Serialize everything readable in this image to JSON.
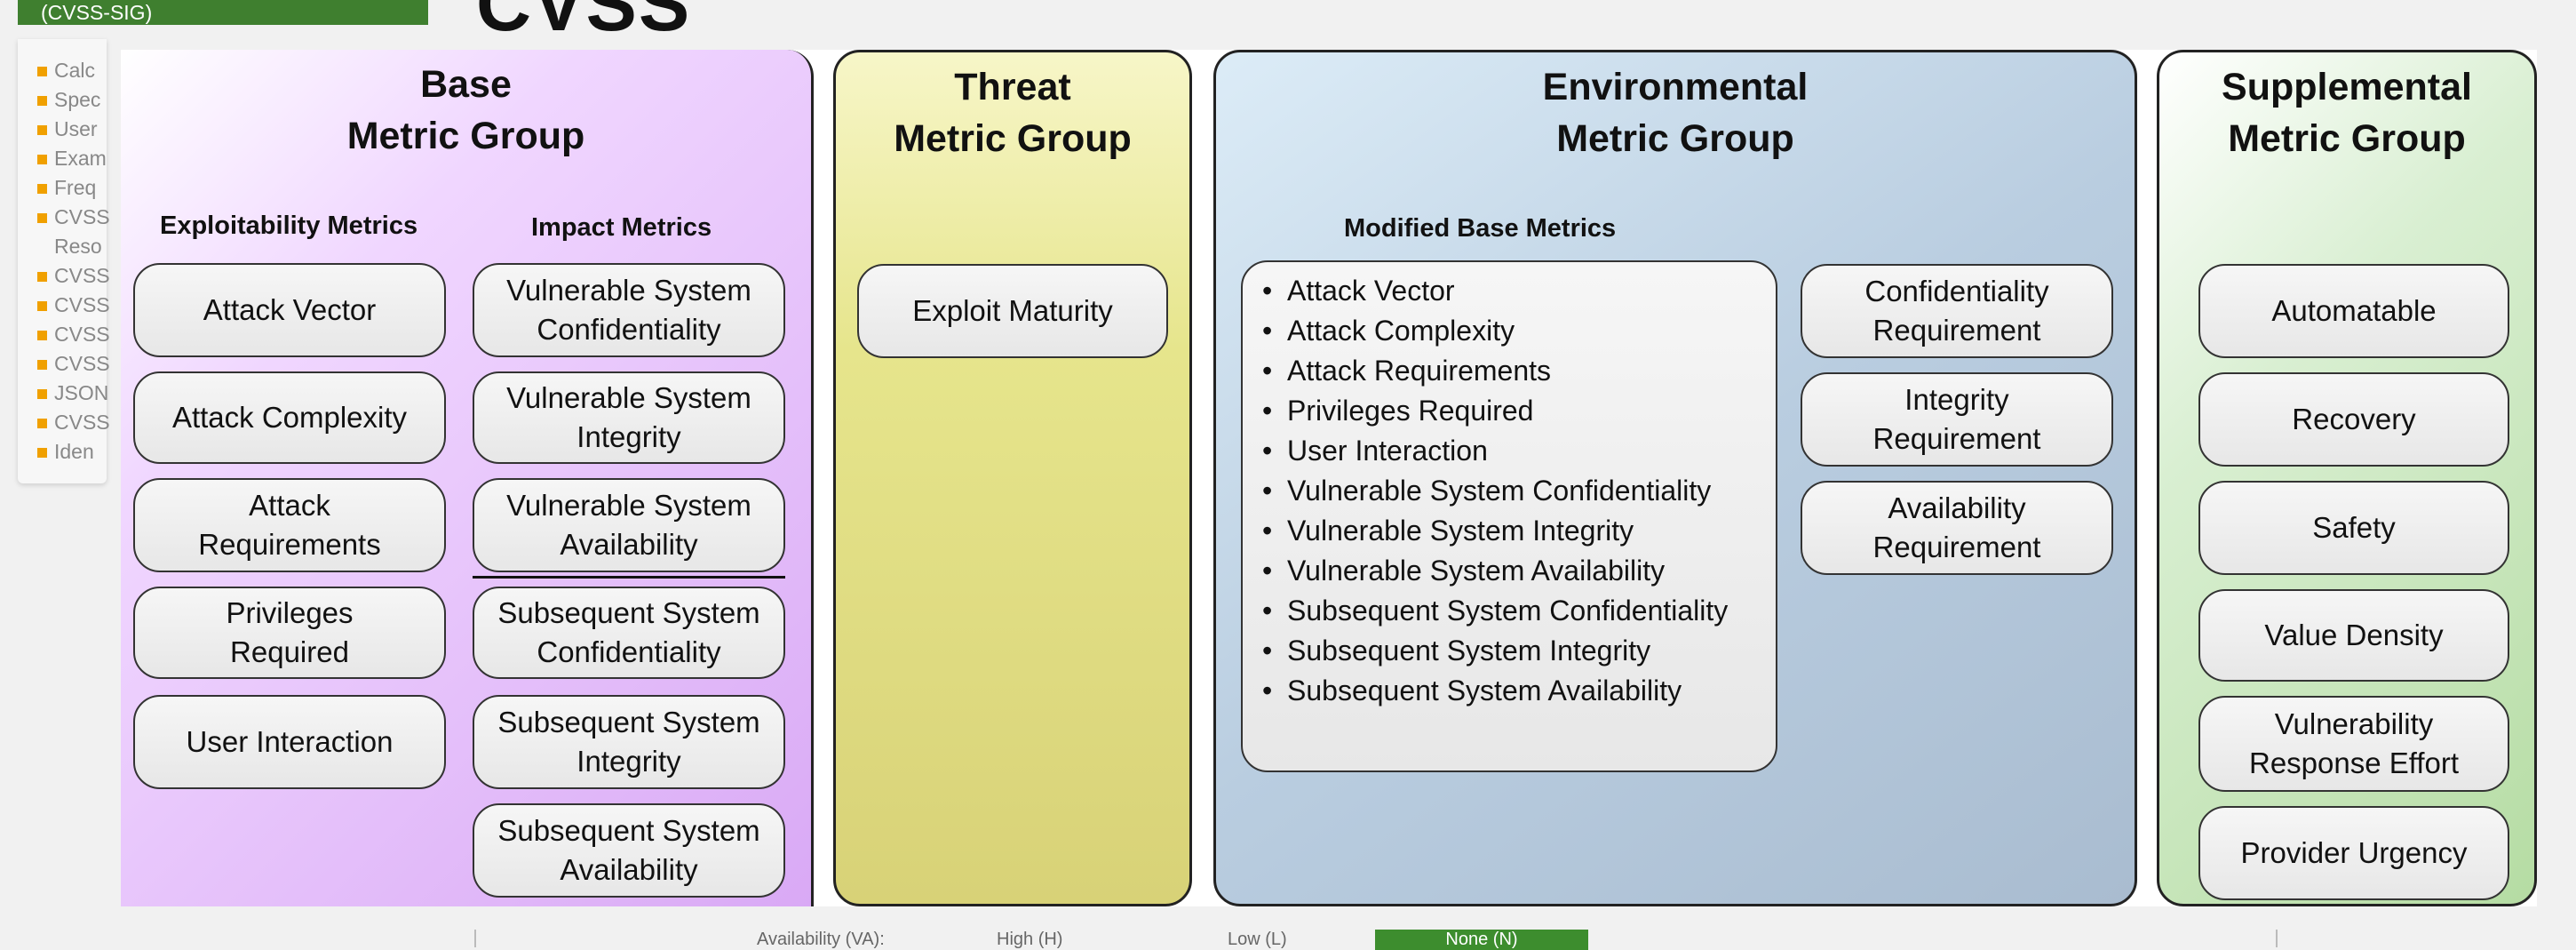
{
  "background": {
    "header_text": "(CVSS-SIG)",
    "logo_text": "CVSS",
    "sidebar_items": [
      "Calc",
      "Spec",
      "User",
      "Exam",
      "Freq",
      "CVSS",
      "Reso",
      "CVSS",
      "CVSS",
      "CVSS",
      "CVSS",
      "JSON",
      "CVSS",
      "Iden"
    ],
    "bottom_row": {
      "label": "Availability (VA):",
      "opt1": "High (H)",
      "opt2": "Low (L)",
      "opt3": "None (N)"
    }
  },
  "groups": {
    "base": {
      "title": [
        "Base",
        "Metric Group"
      ],
      "exploitability_heading": "Exploitability Metrics",
      "impact_heading": "Impact Metrics",
      "exploitability": [
        "Attack Vector",
        "Attack Complexity",
        "Attack\nRequirements",
        "Privileges\nRequired",
        "User Interaction"
      ],
      "impact": [
        "Vulnerable System\nConfidentiality",
        "Vulnerable System\nIntegrity",
        "Vulnerable System\nAvailability",
        "Subsequent System\nConfidentiality",
        "Subsequent System\nIntegrity",
        "Subsequent System\nAvailability"
      ]
    },
    "threat": {
      "title": [
        "Threat",
        "Metric Group"
      ],
      "items": [
        "Exploit Maturity"
      ]
    },
    "environmental": {
      "title": [
        "Environmental",
        "Metric Group"
      ],
      "modified_heading": "Modified Base Metrics",
      "modified": [
        "Attack Vector",
        "Attack Complexity",
        "Attack Requirements",
        "Privileges Required",
        "User Interaction",
        "Vulnerable System Confidentiality",
        "Vulnerable System Integrity",
        "Vulnerable System Availability",
        "Subsequent System Confidentiality",
        "Subsequent System Integrity",
        "Subsequent System Availability"
      ],
      "requirements": [
        "Confidentiality\nRequirement",
        "Integrity\nRequirement",
        "Availability\nRequirement"
      ]
    },
    "supplemental": {
      "title": [
        "Supplemental",
        "Metric Group"
      ],
      "items": [
        "Automatable",
        "Recovery",
        "Safety",
        "Value Density",
        "Vulnerability\nResponse Effort",
        "Provider Urgency"
      ]
    }
  }
}
